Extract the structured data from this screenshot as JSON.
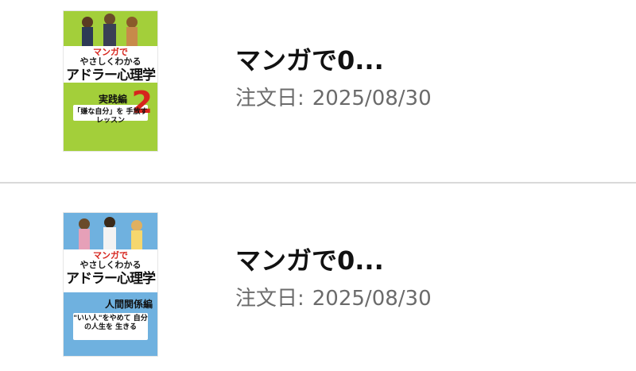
{
  "orders": [
    {
      "title": "マンガで0...",
      "date_label": "注文日:",
      "date_value": "2025/08/30",
      "cover": {
        "kana_top": "マンガで",
        "kana_bottom": "やさしくわかる",
        "main_title": "アドラー心理学",
        "volume_label": "実践編",
        "volume_number": "2",
        "blurb": "「嫌な自分」を 手放すレッスン",
        "theme_color": "#a3cf3a"
      }
    },
    {
      "title": "マンガで0...",
      "date_label": "注文日:",
      "date_value": "2025/08/30",
      "cover": {
        "kana_top": "マンガで",
        "kana_bottom": "やさしくわかる",
        "main_title": "アドラー心理学",
        "volume_label": "人間関係編",
        "blurb": "\"いい人\"をやめて 自分の人生を 生きる",
        "theme_color": "#6fb1df"
      }
    }
  ]
}
